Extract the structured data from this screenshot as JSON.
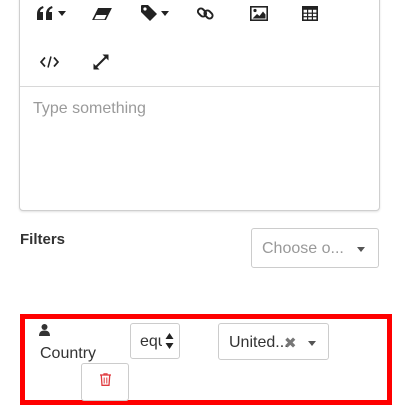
{
  "toolbar": {
    "buttons": [
      {
        "name": "quote",
        "icon": "quote-icon",
        "has_dropdown": true
      },
      {
        "name": "eraser",
        "icon": "eraser-icon",
        "has_dropdown": false
      },
      {
        "name": "tag",
        "icon": "tag-icon",
        "has_dropdown": true
      },
      {
        "name": "link",
        "icon": "link-icon",
        "has_dropdown": false
      },
      {
        "name": "image",
        "icon": "image-icon",
        "has_dropdown": false
      },
      {
        "name": "table",
        "icon": "table-icon",
        "has_dropdown": false
      },
      {
        "name": "code",
        "icon": "code-icon",
        "has_dropdown": false
      },
      {
        "name": "fullscreen",
        "icon": "expand-icon",
        "has_dropdown": false
      }
    ]
  },
  "editor": {
    "placeholder": "Type something"
  },
  "filters": {
    "label": "Filters",
    "choose_placeholder": "Choose o...",
    "rule": {
      "field_label": "Country",
      "operator_value": "equ",
      "value_text": "United..."
    }
  },
  "colors": {
    "highlight_border": "#ff0000",
    "delete_icon": "#e0393e"
  }
}
